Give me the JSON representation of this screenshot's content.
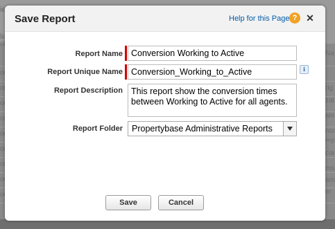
{
  "background": {
    "header_left": "ie A",
    "rows_left": [
      "lid",
      "ol",
      "ou",
      "ou",
      "ou",
      "ou",
      "ou",
      "ou",
      "ou",
      "ou",
      "ou",
      "ou"
    ],
    "rows_right": [
      "Na",
      "",
      "rig",
      "zal",
      "ale",
      "nso",
      "mp",
      "cia",
      "ms",
      "am",
      "er",
      ""
    ]
  },
  "dialog": {
    "title": "Save Report",
    "help_link": "Help for this Page",
    "help_icon": "?",
    "close_icon": "✕"
  },
  "form": {
    "report_name_label": "Report Name",
    "report_name_value": "Conversion Working to Active",
    "unique_name_label": "Report Unique Name",
    "unique_name_value": "Conversion_Working_to_Active",
    "info_icon": "i",
    "description_label": "Report Description",
    "description_value": "This report show the conversion times between Working to Active for all agents.",
    "folder_label": "Report Folder",
    "folder_value": "Propertybase Administrative Reports"
  },
  "buttons": {
    "save": "Save",
    "cancel": "Cancel"
  }
}
